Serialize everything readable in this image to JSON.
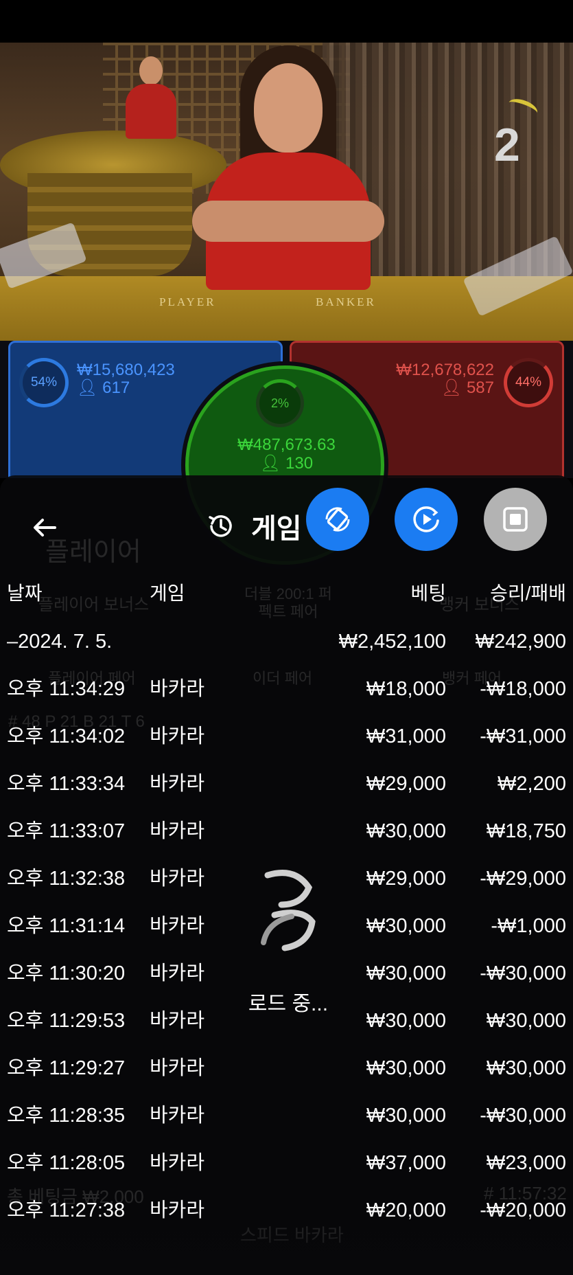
{
  "video": {
    "round_number": "2",
    "felt_labels": {
      "player": "PLAYER",
      "banker": "BANKER"
    }
  },
  "bets": {
    "player": {
      "percent": "54%",
      "amount": "₩15,680,423",
      "players": "617"
    },
    "tie": {
      "percent": "2%",
      "amount": "₩487,673.63",
      "players": "130"
    },
    "banker": {
      "percent": "44%",
      "amount": "₩12,678,622",
      "players": "587"
    }
  },
  "background_panel": {
    "player_label": "플레이어",
    "player_bonus": "플레이어 보너스",
    "perfect_pair": "더블 200:1 퍼펙트 페어",
    "either_pair": "이더 페어",
    "player_pair": "플레이어 페어",
    "banker_pair": "뱅커 페어",
    "banker_bonus": "뱅커 보너스",
    "road_stats": "# 48  P 21  B 21  T 6",
    "total_bet": "총 베팅금  ₩2,000",
    "table_name": "스피드 바카라",
    "time": "# 11:57:32"
  },
  "history": {
    "title": "게임 기록",
    "columns": {
      "date": "날짜",
      "game": "게임",
      "bet": "베팅",
      "winloss": "승리/패배"
    },
    "summary": {
      "date": "–2024. 7. 5.",
      "bet": "₩2,452,100",
      "winloss": "₩242,900"
    },
    "rows": [
      {
        "time": "오후 11:34:29",
        "game": "바카라",
        "bet": "₩18,000",
        "winloss": "-₩18,000"
      },
      {
        "time": "오후 11:34:02",
        "game": "바카라",
        "bet": "₩31,000",
        "winloss": "-₩31,000"
      },
      {
        "time": "오후 11:33:34",
        "game": "바카라",
        "bet": "₩29,000",
        "winloss": "₩2,200"
      },
      {
        "time": "오후 11:33:07",
        "game": "바카라",
        "bet": "₩30,000",
        "winloss": "₩18,750"
      },
      {
        "time": "오후 11:32:38",
        "game": "바카라",
        "bet": "₩29,000",
        "winloss": "-₩29,000"
      },
      {
        "time": "오후 11:31:14",
        "game": "바카라",
        "bet": "₩30,000",
        "winloss": "-₩1,000"
      },
      {
        "time": "오후 11:30:20",
        "game": "바카라",
        "bet": "₩30,000",
        "winloss": "-₩30,000"
      },
      {
        "time": "오후 11:29:53",
        "game": "바카라",
        "bet": "₩30,000",
        "winloss": "₩30,000"
      },
      {
        "time": "오후 11:29:27",
        "game": "바카라",
        "bet": "₩30,000",
        "winloss": "₩30,000"
      },
      {
        "time": "오후 11:28:35",
        "game": "바카라",
        "bet": "₩30,000",
        "winloss": "-₩30,000"
      },
      {
        "time": "오후 11:28:05",
        "game": "바카라",
        "bet": "₩37,000",
        "winloss": "₩23,000"
      },
      {
        "time": "오후 11:27:38",
        "game": "바카라",
        "bet": "₩20,000",
        "winloss": "-₩20,000"
      }
    ],
    "loading_text": "로드 중..."
  },
  "icons": {
    "back": "arrow-left-icon",
    "history": "history-clock-icon",
    "fab1": "rotate-device-icon",
    "fab2": "play-circle-icon",
    "fab3": "stop-square-icon",
    "loader": "spinner-logo-icon"
  },
  "colors": {
    "player": "#2e6fd6",
    "banker": "#b3322e",
    "tie": "#2aa31e",
    "fab_blue": "#1b7cf2",
    "fab_gray": "#b3b3b3"
  }
}
